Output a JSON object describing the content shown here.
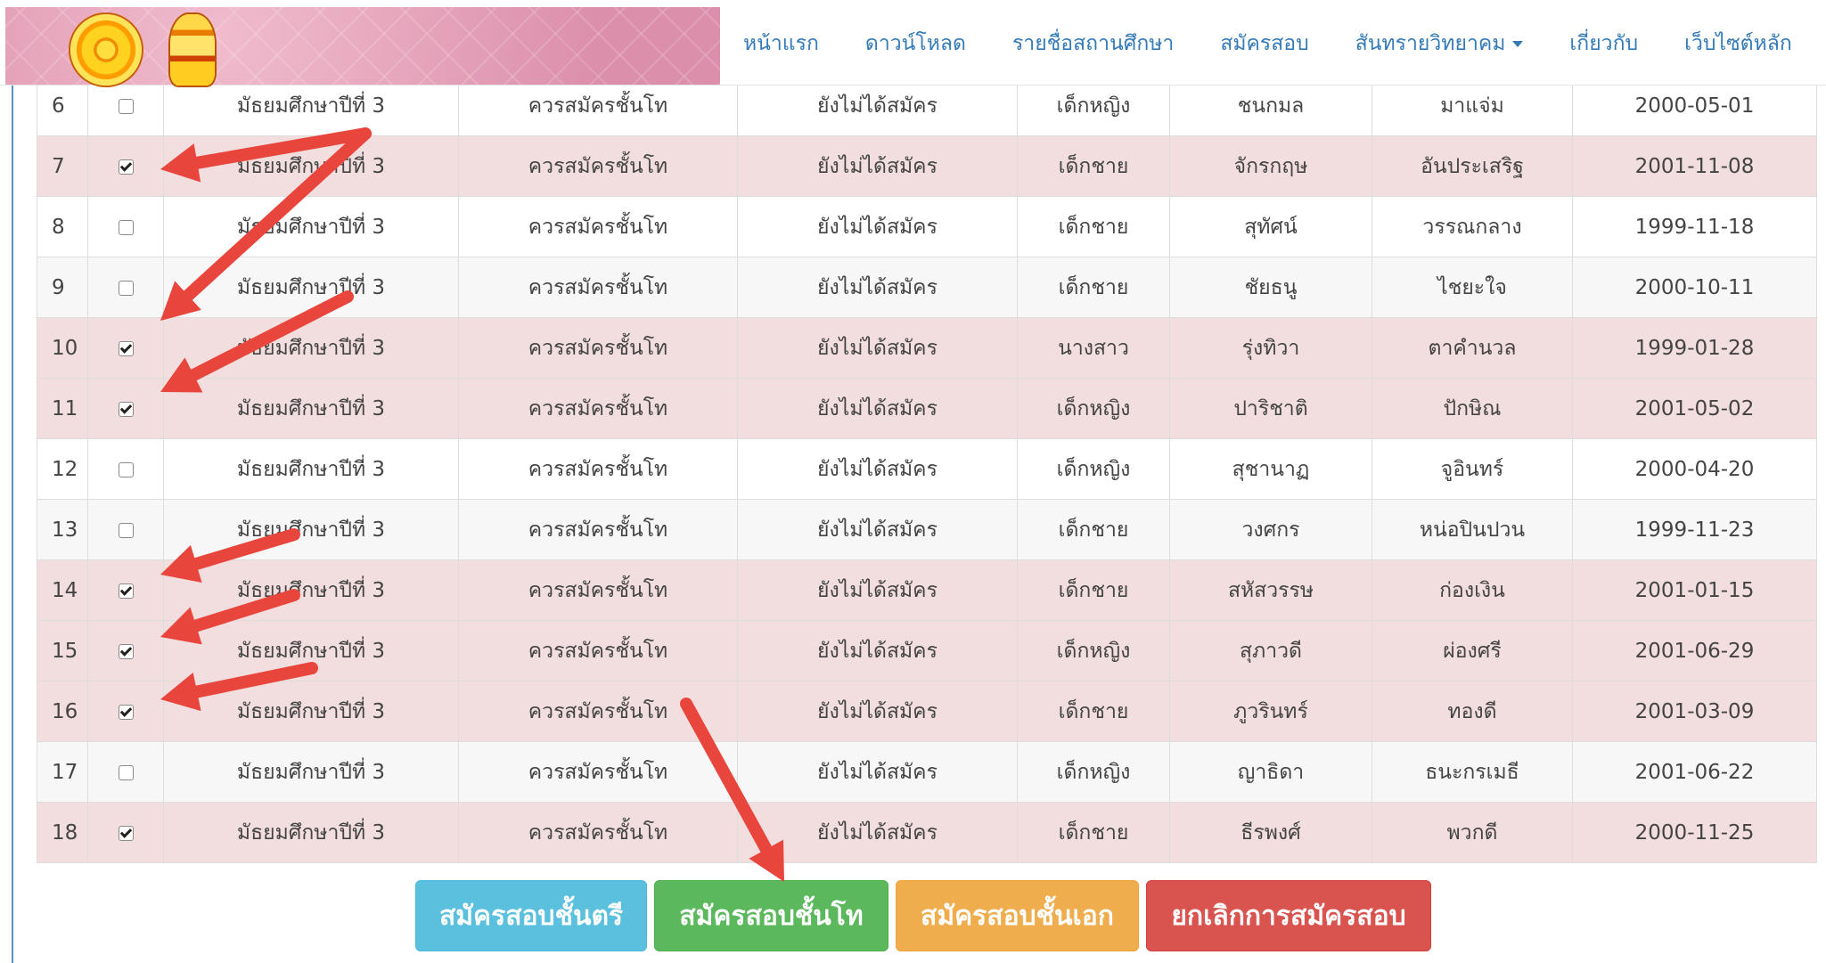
{
  "nav": {
    "items": [
      {
        "label": "หน้าแรก"
      },
      {
        "label": "ดาวน์โหลด"
      },
      {
        "label": "รายชื่อสถานศึกษา"
      },
      {
        "label": "สมัครสอบ"
      },
      {
        "label": "สันทรายวิทยาคม",
        "dropdown": true
      },
      {
        "label": "เกี่ยวกับ"
      },
      {
        "label": "เว็บไซต์หลัก"
      }
    ],
    "link_color": "#337ab7"
  },
  "banner": {
    "icons": [
      "dharma-wheel-emblem",
      "ministry-seal-emblem"
    ],
    "color": "#e7a6bd"
  },
  "table": {
    "rows": [
      {
        "no": "6",
        "checked": false,
        "level": "มัธยมศึกษาปีที่ 3",
        "eligibility": "ควรสมัครชั้นโท",
        "status": "ยังไม่ได้สมัคร",
        "prefix": "เด็กหญิง",
        "first_name": "ชนกมล",
        "last_name": "มาแจ่ม",
        "birthdate": "2000-05-01"
      },
      {
        "no": "7",
        "checked": true,
        "level": "มัธยมศึกษาปีที่ 3",
        "eligibility": "ควรสมัครชั้นโท",
        "status": "ยังไม่ได้สมัคร",
        "prefix": "เด็กชาย",
        "first_name": "จักรกฤษ",
        "last_name": "อันประเสริฐ",
        "birthdate": "2001-11-08"
      },
      {
        "no": "8",
        "checked": false,
        "level": "มัธยมศึกษาปีที่ 3",
        "eligibility": "ควรสมัครชั้นโท",
        "status": "ยังไม่ได้สมัคร",
        "prefix": "เด็กชาย",
        "first_name": "สุทัศน์",
        "last_name": "วรรณกลาง",
        "birthdate": "1999-11-18"
      },
      {
        "no": "9",
        "checked": false,
        "level": "มัธยมศึกษาปีที่ 3",
        "eligibility": "ควรสมัครชั้นโท",
        "status": "ยังไม่ได้สมัคร",
        "prefix": "เด็กชาย",
        "first_name": "ชัยธนู",
        "last_name": "ไชยะใจ",
        "birthdate": "2000-10-11"
      },
      {
        "no": "10",
        "checked": true,
        "level": "มัธยมศึกษาปีที่ 3",
        "eligibility": "ควรสมัครชั้นโท",
        "status": "ยังไม่ได้สมัคร",
        "prefix": "นางสาว",
        "first_name": "รุ่งทิวา",
        "last_name": "ตาคำนวล",
        "birthdate": "1999-01-28"
      },
      {
        "no": "11",
        "checked": true,
        "level": "มัธยมศึกษาปีที่ 3",
        "eligibility": "ควรสมัครชั้นโท",
        "status": "ยังไม่ได้สมัคร",
        "prefix": "เด็กหญิง",
        "first_name": "ปาริชาติ",
        "last_name": "ปักษิณ",
        "birthdate": "2001-05-02"
      },
      {
        "no": "12",
        "checked": false,
        "level": "มัธยมศึกษาปีที่ 3",
        "eligibility": "ควรสมัครชั้นโท",
        "status": "ยังไม่ได้สมัคร",
        "prefix": "เด็กหญิง",
        "first_name": "สุชานาฏ",
        "last_name": "จูอินทร์",
        "birthdate": "2000-04-20"
      },
      {
        "no": "13",
        "checked": false,
        "level": "มัธยมศึกษาปีที่ 3",
        "eligibility": "ควรสมัครชั้นโท",
        "status": "ยังไม่ได้สมัคร",
        "prefix": "เด็กชาย",
        "first_name": "วงศกร",
        "last_name": "หน่อปินปวน",
        "birthdate": "1999-11-23"
      },
      {
        "no": "14",
        "checked": true,
        "level": "มัธยมศึกษาปีที่ 3",
        "eligibility": "ควรสมัครชั้นโท",
        "status": "ยังไม่ได้สมัคร",
        "prefix": "เด็กชาย",
        "first_name": "สหัสวรรษ",
        "last_name": "ก่องเงิน",
        "birthdate": "2001-01-15"
      },
      {
        "no": "15",
        "checked": true,
        "level": "มัธยมศึกษาปีที่ 3",
        "eligibility": "ควรสมัครชั้นโท",
        "status": "ยังไม่ได้สมัคร",
        "prefix": "เด็กหญิง",
        "first_name": "สุภาวดี",
        "last_name": "ผ่องศรี",
        "birthdate": "2001-06-29"
      },
      {
        "no": "16",
        "checked": true,
        "level": "มัธยมศึกษาปีที่ 3",
        "eligibility": "ควรสมัครชั้นโท",
        "status": "ยังไม่ได้สมัคร",
        "prefix": "เด็กชาย",
        "first_name": "ภูวรินทร์",
        "last_name": "ทองดี",
        "birthdate": "2001-03-09"
      },
      {
        "no": "17",
        "checked": false,
        "level": "มัธยมศึกษาปีที่ 3",
        "eligibility": "ควรสมัครชั้นโท",
        "status": "ยังไม่ได้สมัคร",
        "prefix": "เด็กหญิง",
        "first_name": "ญาธิดา",
        "last_name": "ธนะกรเมธี",
        "birthdate": "2001-06-22"
      },
      {
        "no": "18",
        "checked": true,
        "level": "มัธยมศึกษาปีที่ 3",
        "eligibility": "ควรสมัครชั้นโท",
        "status": "ยังไม่ได้สมัคร",
        "prefix": "เด็กชาย",
        "first_name": "ธีรพงศ์",
        "last_name": "พวกดี",
        "birthdate": "2000-11-25"
      }
    ],
    "checked_row_color": "#f2dede"
  },
  "buttons": {
    "bachelor": "สมัครสอบชั้นตรี",
    "master": "สมัครสอบชั้นโท",
    "doctor": "สมัครสอบชั้นเอก",
    "cancel": "ยกเลิกการสมัครสอบ"
  },
  "annotation": {
    "arrow_color": "#e8453c"
  }
}
